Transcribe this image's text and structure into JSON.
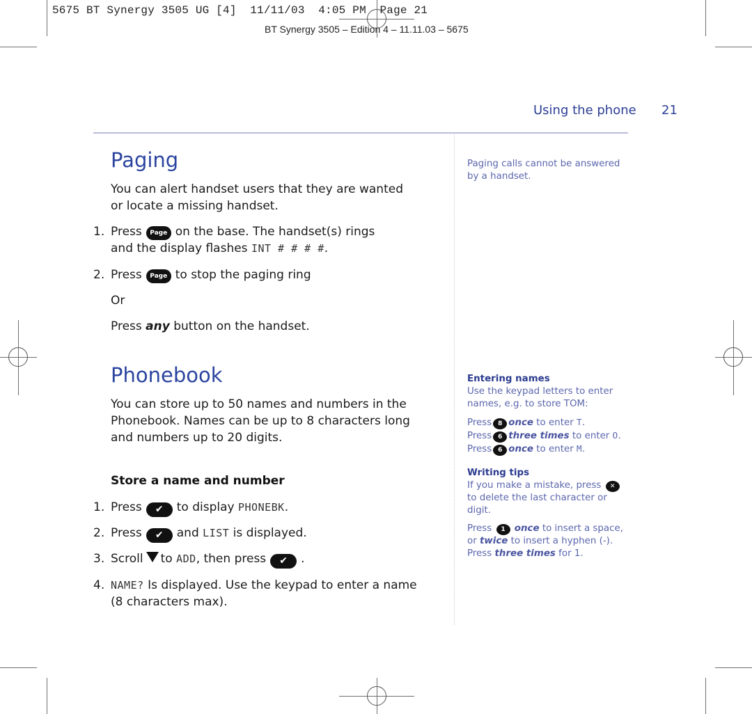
{
  "slug_line": "5675 BT Synergy 3505 UG [4]  11/11/03  4:05 PM  Page 21",
  "edition_line": "BT Synergy 3505 – Edition 4 – 11.11.03 – 5675",
  "running_header": {
    "section": "Using the phone",
    "page_number": "21"
  },
  "paging": {
    "title": "Paging",
    "intro": "You can alert handset users that they are wanted or locate a missing handset.",
    "steps": [
      {
        "num": "1.",
        "pre": "Press",
        "key": "Page",
        "post": "on the base. The handset(s) rings",
        "line2_pre": "and the display flashes",
        "line2_lcd": "INT # # # #",
        "line2_post": "."
      },
      {
        "num": "2.",
        "pre": "Press",
        "key": "Page",
        "post": "to stop the paging ring"
      }
    ],
    "or_label": "Or",
    "alt_pre": "Press",
    "alt_em": "any",
    "alt_post": "button on the handset.",
    "side_note": "Paging calls cannot be answered by a handset."
  },
  "phonebook": {
    "title": "Phonebook",
    "intro": "You can store up to 50 names and numbers in the Phonebook. Names can be up to 8 characters long and numbers up to 20 digits.",
    "subheading": "Store a name and number",
    "steps": [
      {
        "num": "1.",
        "pre": "Press",
        "icon": "ok-check",
        "post": "to display",
        "lcd": "PHONEBK",
        "end": "."
      },
      {
        "num": "2.",
        "pre": "Press",
        "icon": "ok-check",
        "post": "and",
        "lcd": "LIST",
        "end": " is displayed."
      },
      {
        "num": "3.",
        "pre": "Scroll",
        "icon": "scroll-down-triangle",
        "post": "to",
        "lcd": "ADD",
        "end": ", then press"
      },
      {
        "num": "4.",
        "lcd": "NAME?",
        "post": "Is displayed. Use the keypad to enter a name",
        "line2": "(8 characters max)."
      }
    ],
    "entering_names": {
      "heading": "Entering names",
      "intro": "Use the keypad letters to enter names, e.g. to store TOM:",
      "rows": [
        {
          "pre": "Press",
          "key": "8",
          "em": "once",
          "post": "to enter",
          "lcd": "T",
          "end": "."
        },
        {
          "pre": "Press",
          "key": "6",
          "em": "three times",
          "post": "to enter",
          "lcd": "O",
          "end": "."
        },
        {
          "pre": "Press",
          "key": "6",
          "em": "once",
          "post": "to enter",
          "lcd": "M",
          "end": "."
        }
      ]
    },
    "writing_tips": {
      "heading": "Writing tips",
      "tip1_pre": "If you make a mistake, press",
      "tip1_key": "✕",
      "tip1_post": "to delete the last character or digit.",
      "tip2_pre": "Press",
      "tip2_key": "1",
      "tip2_em1": "once",
      "tip2_mid1": "to insert a space, or",
      "tip2_em2": "twice",
      "tip2_mid2": "to insert a hyphen (-). Press",
      "tip2_em3": "three times",
      "tip2_end": "for 1."
    }
  }
}
